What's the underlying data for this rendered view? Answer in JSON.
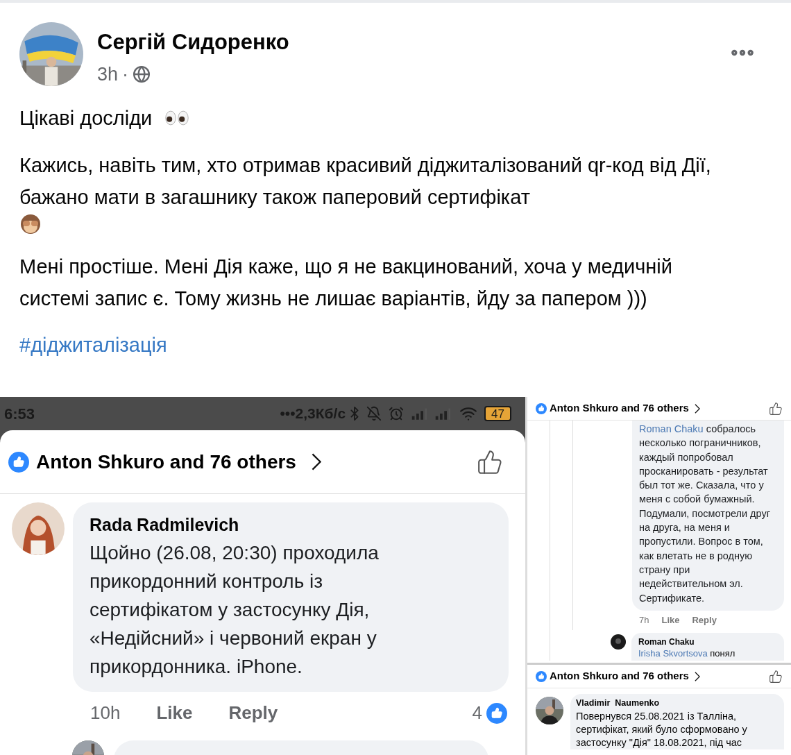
{
  "post": {
    "author": "Сергій Сидоренко",
    "time": "3h",
    "separator": "·",
    "paragraphs": [
      {
        "text": "Цікаві досліди",
        "kind": "eyes"
      },
      {
        "text": "Кажись, навіть тим, хто отримав красивий діджиталізований qr-код від Дії, бажано мати в загашнику також паперовий сертифікат",
        "kind": "monkey"
      },
      {
        "text": "Мені простіше. Мені Дія каже, що я не вакцинований, хоча у медичній системі запис є.  Тому жизнь не лишає варіантів, йду за папером )))"
      }
    ],
    "hashtag": "#діджиталізація"
  },
  "phone_screenshot": {
    "status_bar": {
      "time": "6:53",
      "speed": "•••2,3Кб/с",
      "battery": "47"
    },
    "reactions": "Anton Shkuro and 76 others",
    "comment": {
      "author": "Rada Radmilevich",
      "text": "Щойно (26.08, 20:30) проходила прикордонний контроль із сертифікатом у застосунку Дія, «Недійсний» і червоний екран у прикордонника. iPhone.",
      "time": "10h",
      "like": "Like",
      "reply": "Reply",
      "like_count": "4"
    }
  },
  "thread_screenshot": {
    "reactions": "Anton Shkuro and 76 others",
    "comment": {
      "mention": "Roman Chaku",
      "text": "собралось несколько пограничников, каждый попробовал просканировать - результат был тот же. Сказала, что у меня с собой бумажный. Подумали, посмотрели друг на друга, на меня и пропустили. Вопрос в том, как влетать не в родную страну при недействительном эл. Сертификате.",
      "time": "7h",
      "like": "Like",
      "reply": "Reply"
    },
    "reply": {
      "author": "Roman Chaku",
      "mention": "Irisha Skvortsova",
      "text": "понял"
    }
  },
  "second_screenshot": {
    "reactions": "Anton Shkuro and 76 others",
    "comment": {
      "author": "Vladimir  Naumenko",
      "lines": [
        "Повернувся 25.08.2021 із Талліна,",
        "сертифікат, який було сформовано у",
        "застосунку \"Дія\" 18.08.2021, під час"
      ]
    }
  }
}
